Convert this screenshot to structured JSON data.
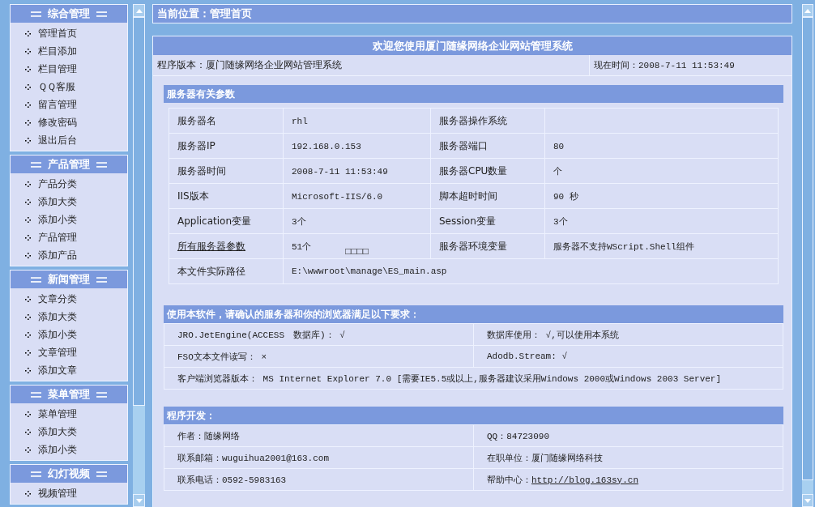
{
  "sidebar": {
    "groups": [
      {
        "title": "综合管理",
        "items": [
          "管理首页",
          "栏目添加",
          "栏目管理",
          "ＱＱ客服",
          "留言管理",
          "修改密码",
          "退出后台"
        ]
      },
      {
        "title": "产品管理",
        "items": [
          "产品分类",
          "添加大类",
          "添加小类",
          "产品管理",
          "添加产品"
        ]
      },
      {
        "title": "新闻管理",
        "items": [
          "文章分类",
          "添加大类",
          "添加小类",
          "文章管理",
          "添加文章"
        ]
      },
      {
        "title": "菜单管理",
        "items": [
          "菜单管理",
          "添加大类",
          "添加小类"
        ]
      },
      {
        "title": "幻灯视频",
        "items": [
          "视频管理"
        ]
      }
    ]
  },
  "breadcrumb": "当前位置：管理首页",
  "welcome": {
    "title": "欢迎您使用厦门随缘网络企业网站管理系统",
    "version": "程序版本：厦门随缘网络企业网站管理系统",
    "time": "现在时间：2008-7-11 11:53:49"
  },
  "server": {
    "title": "服务器有关参数",
    "rows": [
      [
        {
          "kind": "label",
          "text": "服务器名"
        },
        {
          "kind": "value",
          "text": "rhl"
        },
        {
          "kind": "label",
          "text": "服务器操作系统"
        },
        {
          "kind": "value"
        }
      ],
      [
        {
          "kind": "label",
          "text": "服务器IP"
        },
        {
          "kind": "value",
          "text": "192.168.0.153"
        },
        {
          "kind": "label",
          "text": "服务器端口"
        },
        {
          "kind": "value",
          "text": "80"
        }
      ],
      [
        {
          "kind": "label",
          "text": "服务器时间"
        },
        {
          "kind": "value",
          "text": "2008-7-11 11:53:49"
        },
        {
          "kind": "label",
          "text": "服务器CPU数量"
        },
        {
          "kind": "value",
          "text": "个"
        }
      ],
      [
        {
          "kind": "label",
          "text": "IIS版本"
        },
        {
          "kind": "value",
          "text": "Microsoft-IIS/6.0"
        },
        {
          "kind": "label",
          "text": "脚本超时时间"
        },
        {
          "kind": "value",
          "text": "90 秒"
        }
      ],
      [
        {
          "kind": "label",
          "text": "Application变量"
        },
        {
          "kind": "value",
          "text": "3个"
        },
        {
          "kind": "label",
          "text": "Session变量"
        },
        {
          "kind": "value",
          "text": "3个"
        }
      ],
      [
        {
          "kind": "link",
          "text": "所有服务器参数"
        },
        {
          "kind": "value",
          "text": "51个",
          "note": "□□□□"
        },
        {
          "kind": "label",
          "text": "服务器环境变量"
        },
        {
          "kind": "value",
          "text": "服务器不支持WScript.Shell组件"
        }
      ],
      [
        {
          "kind": "label",
          "text": "本文件实际路径"
        },
        {
          "kind": "wide",
          "colspan": 3,
          "text": "E:\\wwwroot\\manage\\ES_main.asp"
        }
      ]
    ]
  },
  "requirements": {
    "title": "使用本软件，请确认的服务器和你的浏览器满足以下要求：",
    "rows": [
      [
        {
          "text": "JRO.JetEngine(ACCESS　数据库)： √"
        },
        {
          "text": "数据库使用： √,可以使用本系统"
        }
      ],
      [
        {
          "text": "FSO文本文件读写： ×"
        },
        {
          "text": "Adodb.Stream: √"
        }
      ],
      [
        {
          "text": "客户端浏览器版本： MS Internet Explorer 7.0 [需要IE5.5或以上,服务器建议采用Windows 2000或Windows 2003 Server]",
          "colspan": 2
        }
      ]
    ]
  },
  "developer": {
    "title": "程序开发：",
    "rows": [
      [
        {
          "text": "作者：随缘网络"
        },
        {
          "text": "QQ：84723090"
        }
      ],
      [
        {
          "text": "联系邮箱：wuguihua2001@163.com"
        },
        {
          "text": "在职单位：厦门随缘网络科技"
        }
      ],
      [
        {
          "text": "联系电话：0592-5983163"
        },
        {
          "text": "帮助中心：",
          "link": "http://blog.163sy.cn"
        }
      ]
    ]
  }
}
